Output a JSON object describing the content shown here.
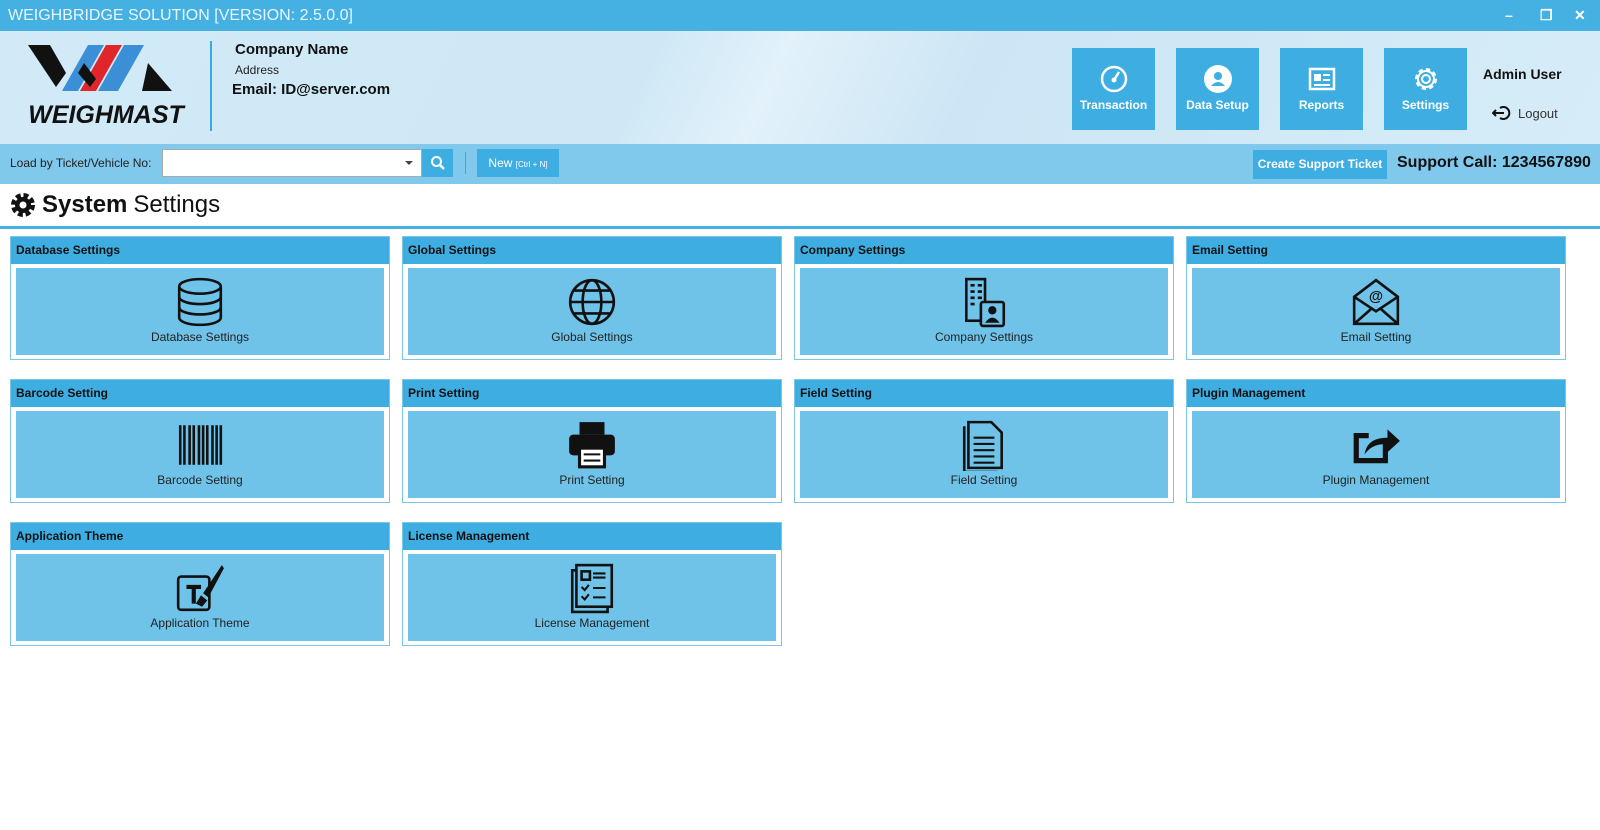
{
  "window": {
    "title": "WEIGHBRIDGE SOLUTION [VERSION: 2.5.0.0]",
    "minimize": "–",
    "restore": "❐",
    "close": "✕"
  },
  "brand": {
    "logo_text": "WEIGHMAST"
  },
  "company": {
    "name": "Company Name",
    "address": "Address",
    "email": "Email: ID@server.com"
  },
  "nav": [
    {
      "label": "Transaction",
      "icon": "speedometer-icon"
    },
    {
      "label": "Data Setup",
      "icon": "user-icon"
    },
    {
      "label": "Reports",
      "icon": "newspaper-icon"
    },
    {
      "label": "Settings",
      "icon": "gear-icon"
    }
  ],
  "user": {
    "name": "Admin User",
    "logout": "Logout"
  },
  "toolbar": {
    "load_label": "Load by Ticket/Vehicle No:",
    "search_value": "",
    "new_label": "New",
    "new_shortcut": "[Ctrl + N]",
    "ticket_label": "Create Support Ticket",
    "support": "Support Call: 1234567890"
  },
  "page": {
    "title_bold": "System",
    "title_rest": "Settings"
  },
  "cards": [
    {
      "header": "Database Settings",
      "label": "Database Settings",
      "icon": "database-icon"
    },
    {
      "header": "Global Settings",
      "label": "Global Settings",
      "icon": "globe-icon"
    },
    {
      "header": "Company Settings",
      "label": "Company Settings",
      "icon": "company-icon"
    },
    {
      "header": "Email Setting",
      "label": "Email Setting",
      "icon": "email-icon"
    },
    {
      "header": "Barcode Setting",
      "label": "Barcode Setting",
      "icon": "barcode-icon"
    },
    {
      "header": "Print Setting",
      "label": "Print Setting",
      "icon": "printer-icon"
    },
    {
      "header": "Field Setting",
      "label": "Field Setting",
      "icon": "document-icon"
    },
    {
      "header": "Plugin Management",
      "label": "Plugin Management",
      "icon": "share-icon"
    },
    {
      "header": "Application Theme",
      "label": "Application Theme",
      "icon": "theme-icon"
    },
    {
      "header": "License Management",
      "label": "License Management",
      "icon": "license-icon"
    }
  ],
  "colors": {
    "accent": "#3eaee2",
    "titlebar": "#45b0e2",
    "toolbar": "#80c8ec",
    "card_body": "#6fc3e8"
  }
}
